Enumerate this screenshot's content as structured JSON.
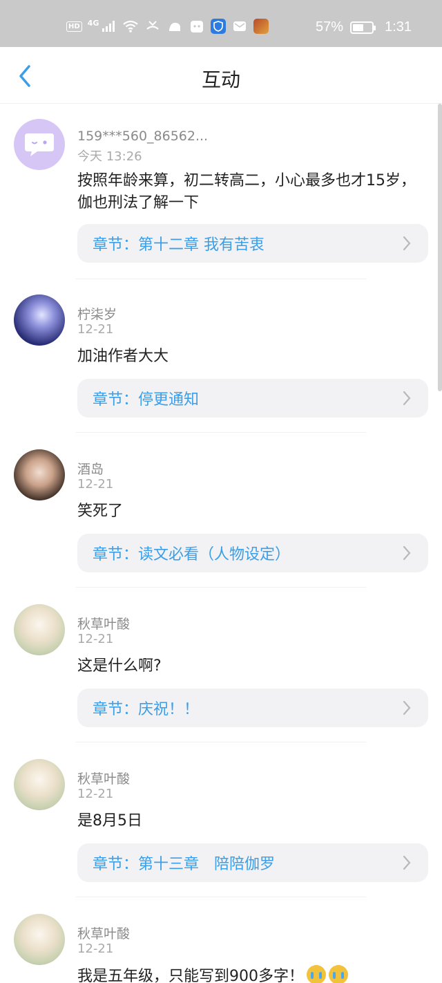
{
  "status_bar": {
    "hd_badge": "HD",
    "network": "4G",
    "battery_percent_text": "57%",
    "battery_level": 0.57,
    "time": "1:31"
  },
  "header": {
    "title": "互动"
  },
  "colors": {
    "accent": "#3a9ee8",
    "chapter_bg": "#f2f2f4",
    "status_bar_bg": "#c9c9c9"
  },
  "comments": [
    {
      "avatar": "default-chat-avatar",
      "username": "159***560_86562...",
      "time": "今天 13:26",
      "text": "按照年龄来算，初二转高二，小心最多也才15岁，伽也刑法了解一下",
      "chapter": "章节：第十二章 我有苦衷"
    },
    {
      "avatar": "purple-art-avatar",
      "username": "柠柒岁",
      "time": "12-21",
      "text": "加油作者大大",
      "chapter": "章节：停更通知"
    },
    {
      "avatar": "girl-photo-avatar",
      "username": "酒岛",
      "time": "12-21",
      "text": "笑死了",
      "chapter": "章节：读文必看（人物设定）"
    },
    {
      "avatar": "anime-girl-avatar",
      "username": "秋草叶酸",
      "time": "12-21",
      "text": "这是什么啊?",
      "chapter": "章节：庆祝！！"
    },
    {
      "avatar": "anime-girl-avatar",
      "username": "秋草叶酸",
      "time": "12-21",
      "text": "是8月5日",
      "chapter": "章节：第十三章　陪陪伽罗"
    },
    {
      "avatar": "anime-girl-avatar",
      "username": "秋草叶酸",
      "time": "12-21",
      "text": "我是五年级，只能写到900多字！",
      "chapter": ""
    }
  ]
}
